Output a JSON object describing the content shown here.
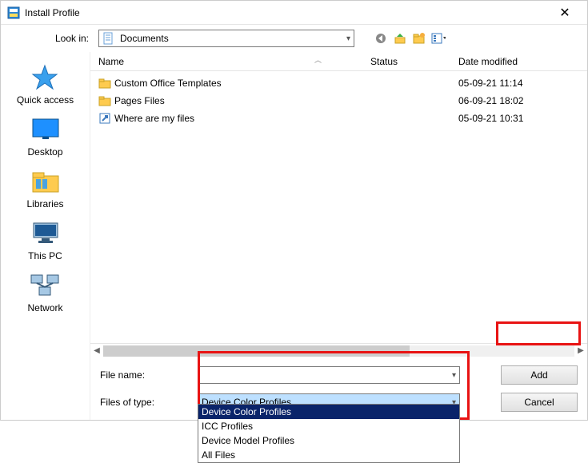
{
  "window": {
    "title": "Install Profile"
  },
  "toolbar": {
    "lookin_label": "Look in:",
    "lookin_value": "Documents"
  },
  "places": [
    {
      "label": "Quick access"
    },
    {
      "label": "Desktop"
    },
    {
      "label": "Libraries"
    },
    {
      "label": "This PC"
    },
    {
      "label": "Network"
    }
  ],
  "columns": {
    "name": "Name",
    "status": "Status",
    "date": "Date modified"
  },
  "files": [
    {
      "name": "Custom Office Templates",
      "date": "05-09-21 11:14",
      "type": "folder"
    },
    {
      "name": "Pages Files",
      "date": "06-09-21 18:02",
      "type": "folder"
    },
    {
      "name": "Where are my files",
      "date": "05-09-21 10:31",
      "type": "shortcut"
    }
  ],
  "form": {
    "filename_label": "File name:",
    "filename_value": "",
    "filetype_label": "Files of type:",
    "filetype_value": "Device Color Profiles",
    "add_button": "Add",
    "cancel_button": "Cancel"
  },
  "filetype_options": [
    "Device Color Profiles",
    "ICC Profiles",
    "Device Model Profiles",
    "All Files"
  ]
}
